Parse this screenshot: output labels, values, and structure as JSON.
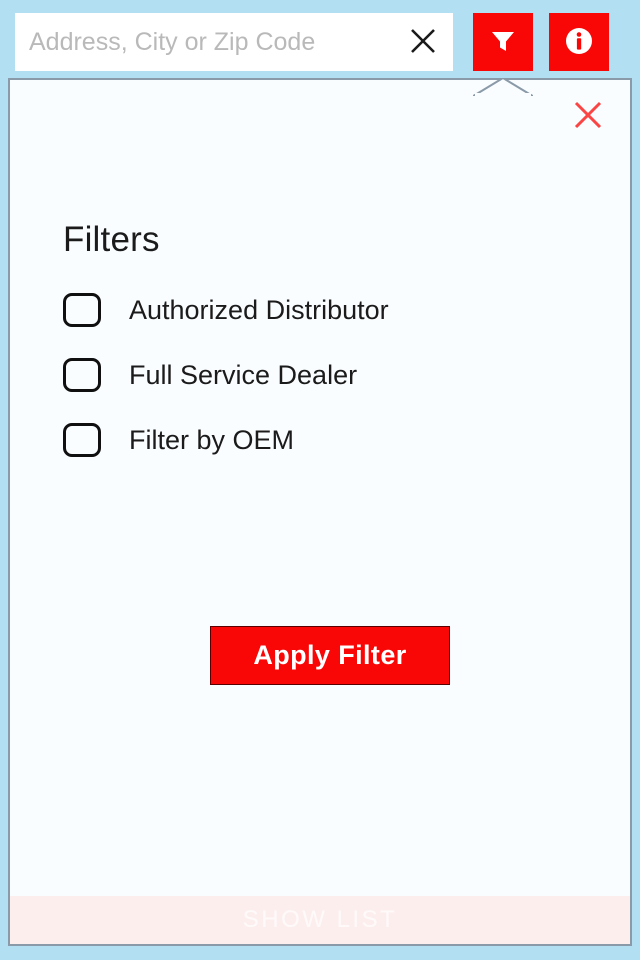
{
  "app": {
    "background_color": "#b3dff2",
    "accent_color": "#f90606"
  },
  "search": {
    "placeholder": "Address, City or Zip Code",
    "value": "",
    "clear_icon": "close-x-icon"
  },
  "toolbar": {
    "filter_button": {
      "icon": "funnel-filter-icon",
      "label": "",
      "active": true
    },
    "info_button": {
      "icon": "info-circle-icon",
      "label": ""
    }
  },
  "filter_panel": {
    "title": "Filters",
    "close_icon": "close-x-icon",
    "options": [
      {
        "label": "Authorized Distributor",
        "checked": false
      },
      {
        "label": "Full Service Dealer",
        "checked": false
      },
      {
        "label": "Filter by OEM",
        "checked": false
      }
    ],
    "apply_label": "Apply Filter"
  },
  "bottom_bar": {
    "show_list_label": "SHOW LIST"
  }
}
